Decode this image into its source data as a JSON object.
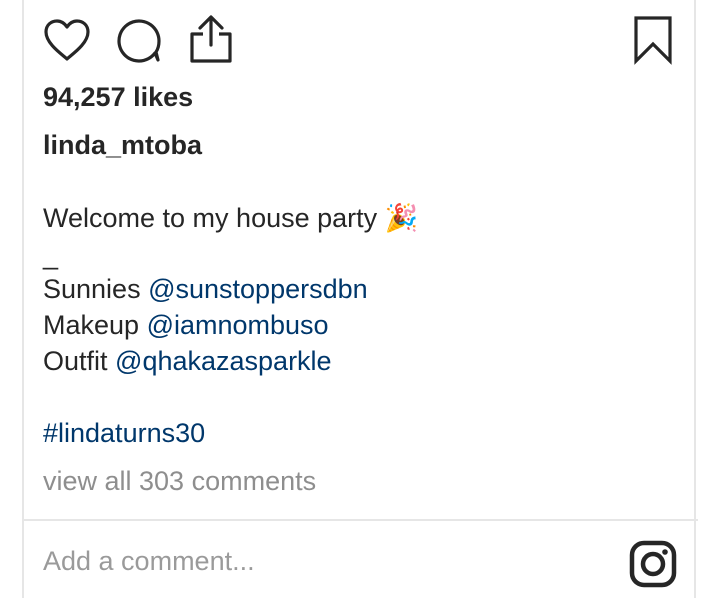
{
  "post": {
    "likes_text": "94,257 likes",
    "username": "linda_mtoba",
    "caption": {
      "line1_text": "Welcome to my house party",
      "line1_emoji": "🎉",
      "separator": "_",
      "credits": [
        {
          "label": "Sunnies",
          "mention": "@sunstoppersdbn"
        },
        {
          "label": "Makeup",
          "mention": "@iamnombuso"
        },
        {
          "label": "Outfit",
          "mention": "@qhakazasparkle"
        }
      ],
      "hashtag": "#lindaturns30"
    },
    "view_comments_text": "view all 303 comments",
    "add_comment_placeholder": "Add a comment..."
  },
  "actions": {
    "icons": [
      "heart-icon",
      "comment-icon",
      "share-icon",
      "bookmark-icon",
      "instagram-icon"
    ]
  },
  "colors": {
    "text": "#262626",
    "mention": "#00376b",
    "muted": "#8e8e8e",
    "divider": "#e6e6e6"
  }
}
